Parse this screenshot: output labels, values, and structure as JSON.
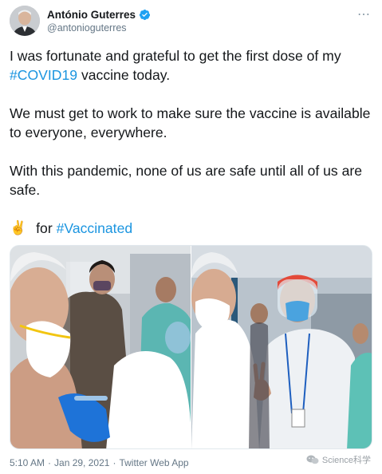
{
  "tweet": {
    "author": {
      "display_name": "António Guterres",
      "handle": "@antonioguterres",
      "verified": true,
      "verified_icon": "verified-badge-icon"
    },
    "more_icon": "ellipsis-icon",
    "more_glyph": "⋯",
    "paragraphs": {
      "p1_before": "I was fortunate and grateful to get the first dose of my ",
      "p1_hashtag": "#COVID19",
      "p1_after": " vaccine today.",
      "p2": "We must get to work to make sure the vaccine is available to everyone, everywhere.",
      "p3": "With this pandemic, none of us are safe until all of us are safe.",
      "p4_emoji": "✌️",
      "p4_text": "for ",
      "p4_hashtag": "#Vaccinated"
    },
    "footer": {
      "time": "5:10 AM",
      "separator": "·",
      "date": "Jan 29, 2021",
      "app": "Twitter Web App"
    }
  },
  "watermark": {
    "text": "Science科学",
    "icon": "wechat-logo-icon"
  },
  "colors": {
    "link": "#1b95e0",
    "text": "#14171a",
    "secondary": "#657786",
    "verified": "#1da1f2"
  }
}
